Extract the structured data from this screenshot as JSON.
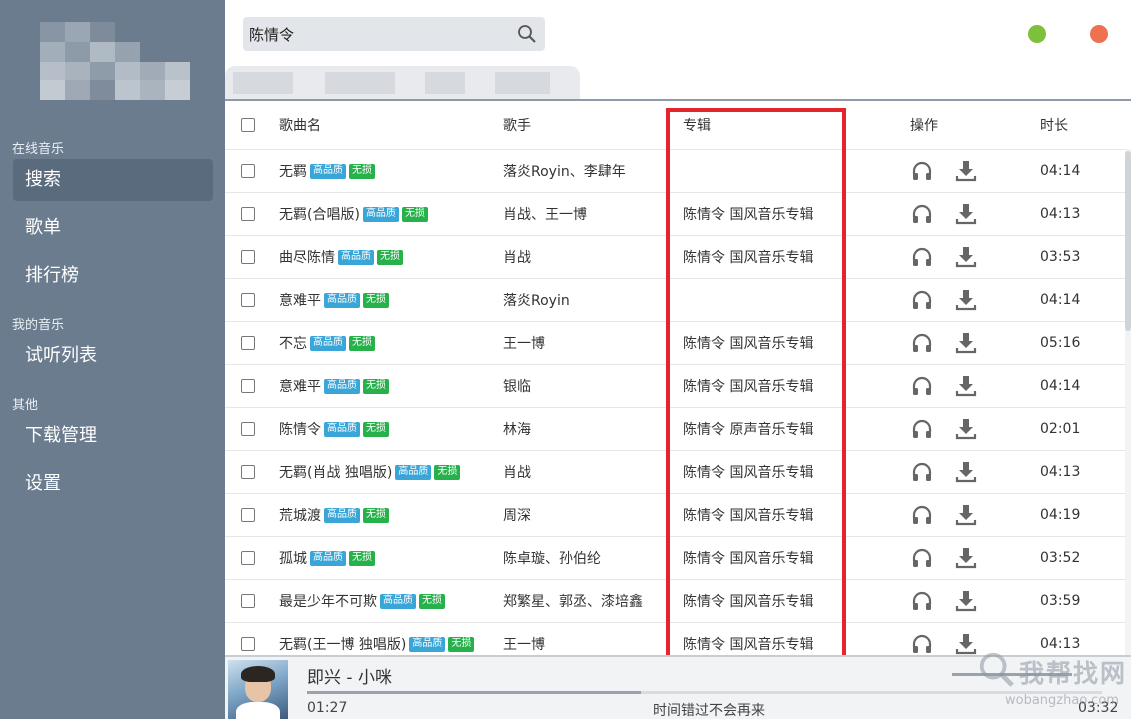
{
  "search": {
    "query": "陈情令"
  },
  "sidebar": {
    "sections": [
      {
        "label": "在线音乐",
        "items": [
          "搜索",
          "歌单",
          "排行榜"
        ]
      },
      {
        "label": "我的音乐",
        "items": [
          "试听列表"
        ]
      },
      {
        "label": "其他",
        "items": [
          "下载管理",
          "设置"
        ]
      }
    ],
    "active_item": "搜索"
  },
  "table": {
    "headers": {
      "name": "歌曲名",
      "artist": "歌手",
      "album": "专辑",
      "ops": "操作",
      "duration": "时长"
    },
    "tag_hq": "高品质",
    "tag_lossless": "无损",
    "rows": [
      {
        "name": "无羁",
        "artist": "落炎Royin、李肆年",
        "album": "",
        "duration": "04:14"
      },
      {
        "name": "无羁(合唱版)",
        "artist": "肖战、王一博",
        "album": "陈情令 国风音乐专辑",
        "duration": "04:13"
      },
      {
        "name": "曲尽陈情",
        "artist": "肖战",
        "album": "陈情令 国风音乐专辑",
        "duration": "03:53"
      },
      {
        "name": "意难平",
        "artist": "落炎Royin",
        "album": "",
        "duration": "04:14"
      },
      {
        "name": "不忘",
        "artist": "王一博",
        "album": "陈情令 国风音乐专辑",
        "duration": "05:16"
      },
      {
        "name": "意难平",
        "artist": "银临",
        "album": "陈情令 国风音乐专辑",
        "duration": "04:14"
      },
      {
        "name": "陈情令",
        "artist": "林海",
        "album": "陈情令 原声音乐专辑",
        "duration": "02:01"
      },
      {
        "name": "无羁(肖战 独唱版)",
        "artist": "肖战",
        "album": "陈情令 国风音乐专辑",
        "duration": "04:13"
      },
      {
        "name": "荒城渡",
        "artist": "周深",
        "album": "陈情令 国风音乐专辑",
        "duration": "04:19"
      },
      {
        "name": "孤城",
        "artist": "陈卓璇、孙伯纶",
        "album": "陈情令 国风音乐专辑",
        "duration": "03:52"
      },
      {
        "name": "最是少年不可欺",
        "artist": "郑繁星、郭丞、漆培鑫",
        "album": "陈情令 国风音乐专辑",
        "duration": "03:59"
      },
      {
        "name": "无羁(王一博 独唱版)",
        "artist": "王一博",
        "album": "陈情令 国风音乐专辑",
        "duration": "04:13"
      }
    ]
  },
  "player": {
    "title": "即兴 - 小咪",
    "current_time": "01:27",
    "total_time": "03:32",
    "lyric": "时间错过不会再来",
    "progress": 0.42
  },
  "watermark": {
    "main": "我帮找网",
    "sub": "wobangzhao.com"
  },
  "colors": {
    "sidebar_bg": "#6b7c8f",
    "highlight": "#e3262b",
    "tag_hq": "#3aa6d8",
    "tag_lossless": "#27b14b",
    "window_min": "#7cc03b",
    "window_close": "#ee7152"
  },
  "icons": [
    "search-icon",
    "headphones-icon",
    "download-icon"
  ]
}
